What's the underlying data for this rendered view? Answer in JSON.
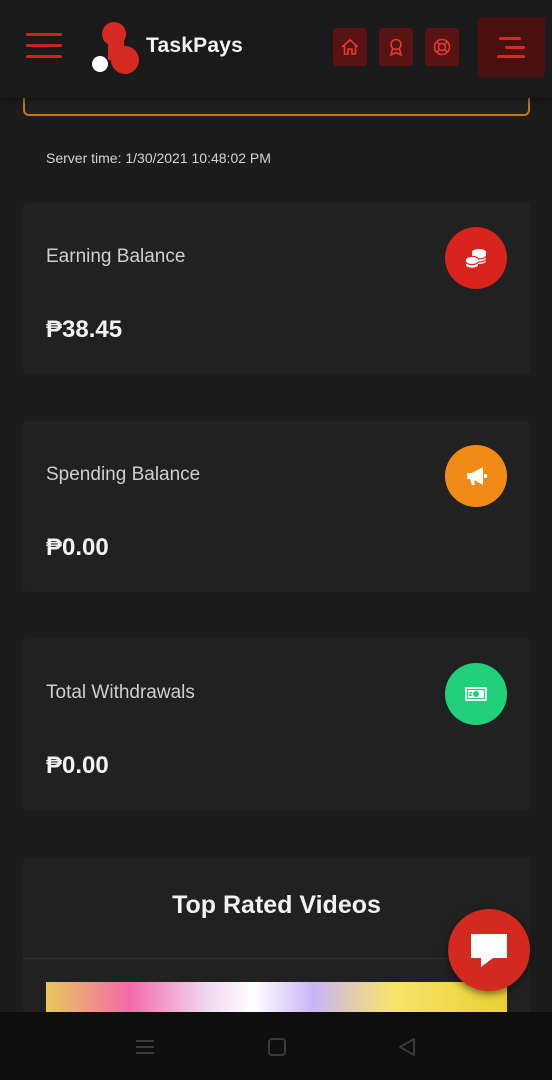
{
  "header": {
    "brand_name": "TaskPays",
    "icons": {
      "menu": "hamburger-icon",
      "home": "home-icon",
      "award": "award-icon",
      "support": "lifebuoy-icon",
      "menu_right": "menu-icon"
    }
  },
  "server_time": "Server time: 1/30/2021 10:48:02 PM",
  "balances": [
    {
      "label": "Earning Balance",
      "value": "₱38.45",
      "icon": "coins-icon",
      "color": "#d9231d"
    },
    {
      "label": "Spending Balance",
      "value": "₱0.00",
      "icon": "megaphone-icon",
      "color": "#f28a16"
    },
    {
      "label": "Total Withdrawals",
      "value": "₱0.00",
      "icon": "money-bill-icon",
      "color": "#21d07a"
    }
  ],
  "videos": {
    "title": "Top Rated Videos"
  },
  "chat": {
    "icon": "chat-icon",
    "color": "#d22a1f"
  },
  "android_nav": {
    "menu": "recents-icon",
    "home": "home-square-icon",
    "back": "back-triangle-icon"
  },
  "colors": {
    "accent_red": "#c8251e",
    "accent_orange_border": "#c9741c",
    "background": "#1c1c1c",
    "card": "#212121"
  }
}
